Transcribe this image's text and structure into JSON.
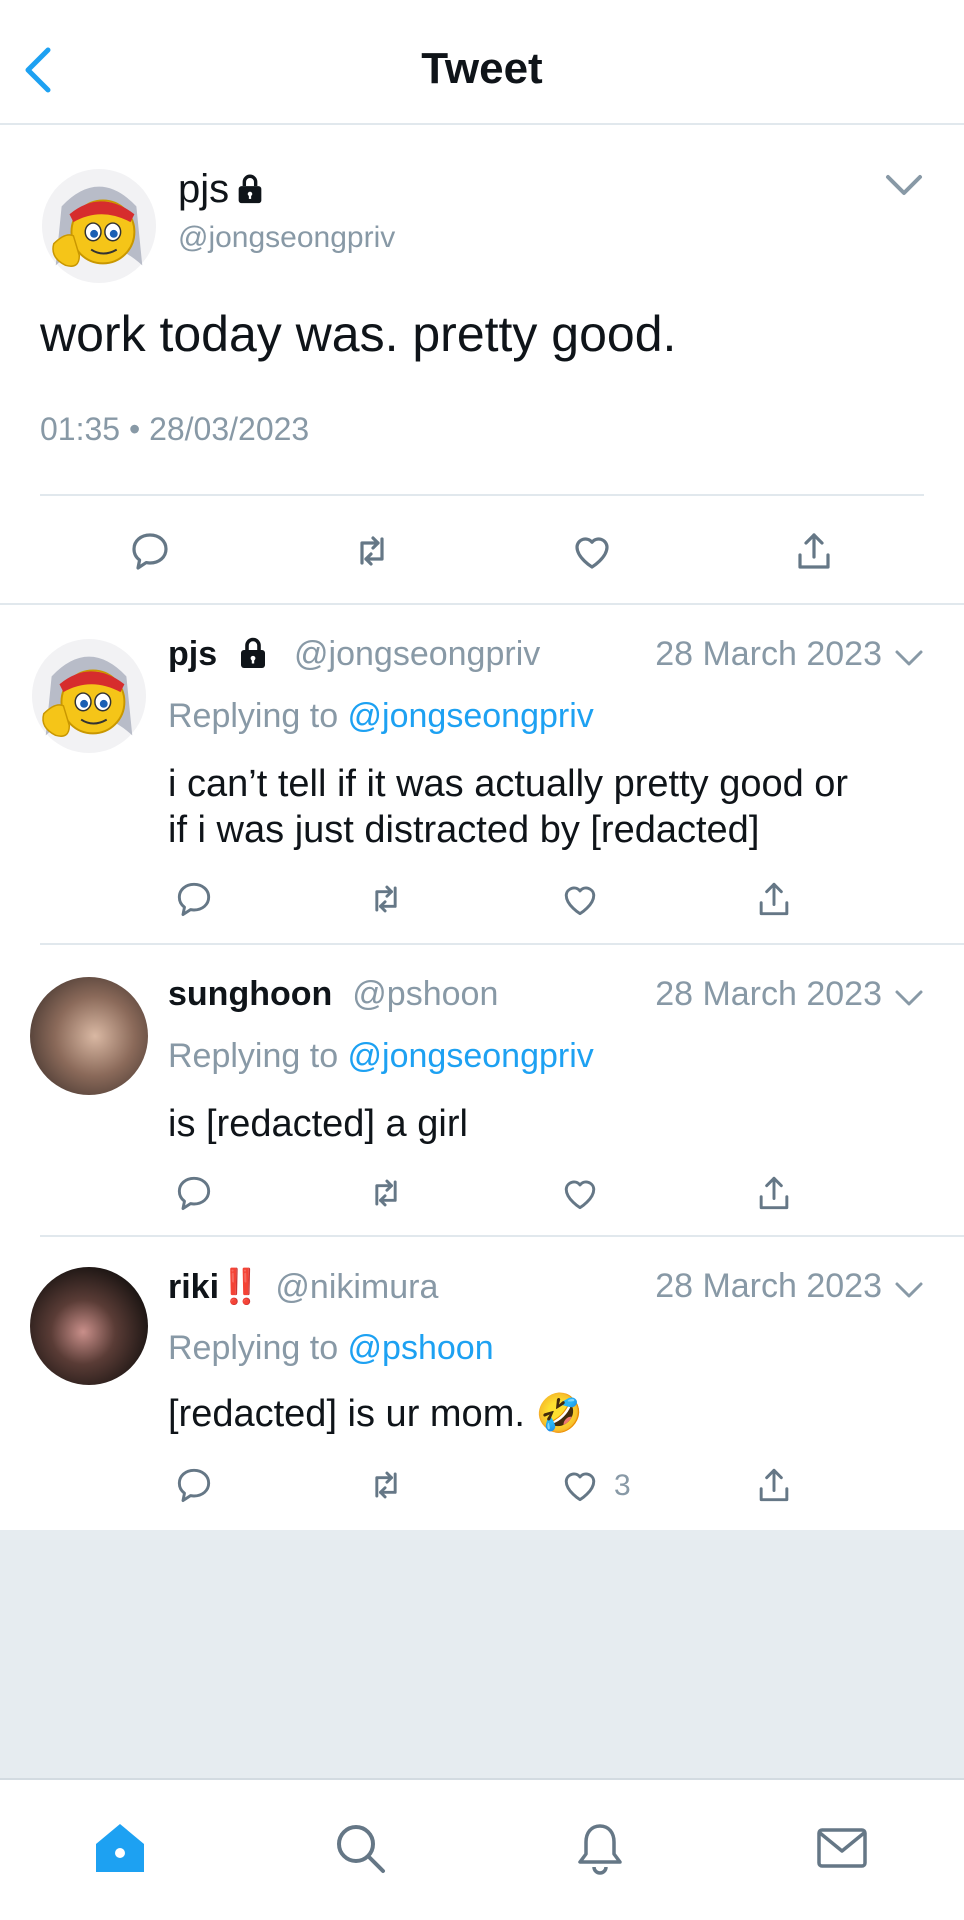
{
  "header": {
    "title": "Tweet"
  },
  "main_tweet": {
    "name": "pjs",
    "handle": "@jongseongpriv",
    "text": "work today was. pretty good.",
    "timestamp": "01:35 • 28/03/2023"
  },
  "replies": [
    {
      "name": "pjs",
      "handle": "@jongseongpriv",
      "date": "28 March 2023",
      "replying_prefix": "Replying to ",
      "replying_to": "@jongseongpriv",
      "text_lines": [
        "i can’t tell if it was actually pretty good or",
        "if i was just distracted by [redacted]"
      ]
    },
    {
      "name": "sunghoon",
      "handle": "@pshoon",
      "date": "28 March 2023",
      "replying_prefix": "Replying to ",
      "replying_to": "@jongseongpriv",
      "text_lines": [
        "is [redacted] a girl"
      ]
    },
    {
      "name": "riki",
      "name_emoji": "‼️",
      "handle": "@nikimura",
      "date": "28 March 2023",
      "replying_prefix": "Replying to ",
      "replying_to": "@pshoon",
      "text_lines": [
        "[redacted] is ur mom."
      ],
      "text_emoji": "🤣",
      "like_count": "3"
    }
  ],
  "tabs": [
    "home-icon",
    "search-icon",
    "notifications-icon",
    "messages-icon"
  ],
  "colors": {
    "accent": "#1da1f2",
    "muted": "#8899a6",
    "divider": "#e1e8ed",
    "empty_bg": "#e6ecf0"
  }
}
